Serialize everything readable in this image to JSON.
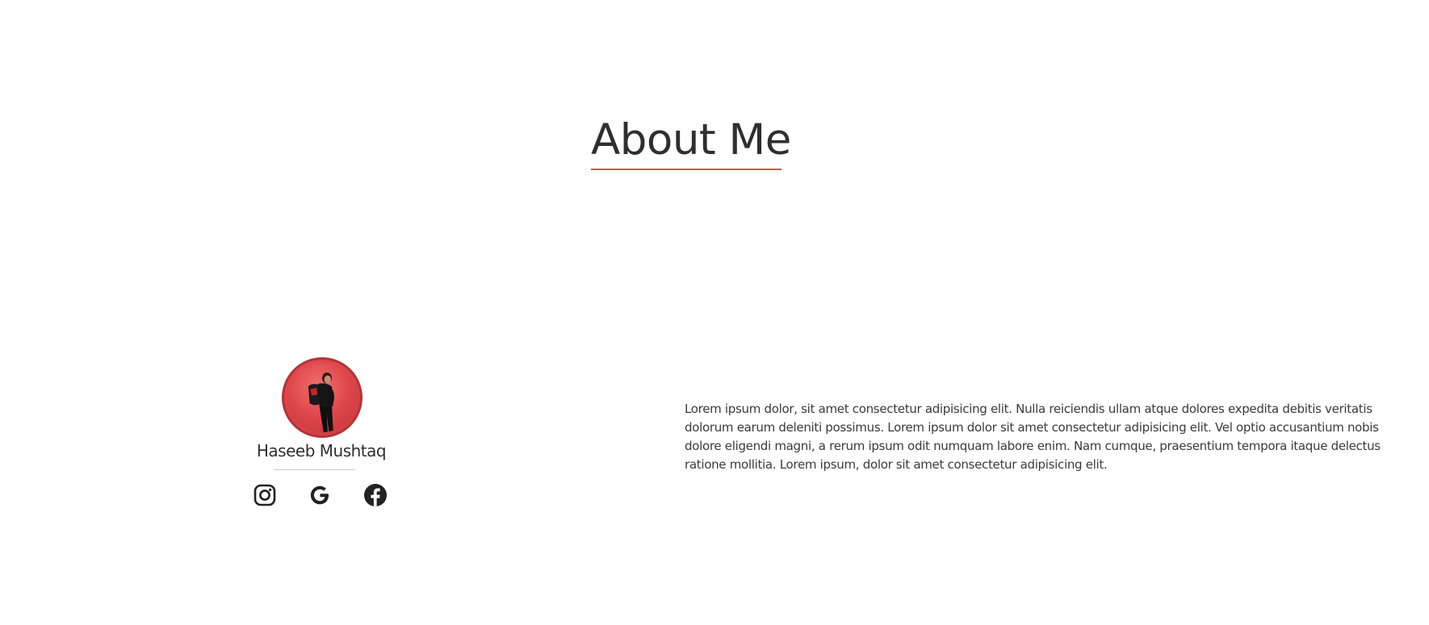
{
  "section": {
    "title": "About Me",
    "accent_color": "#e8494b"
  },
  "profile": {
    "name": "Haseeb Mushtaq",
    "avatar_icon": "person-photo",
    "avatar_border_color": "#b0353a",
    "social_links": [
      {
        "icon": "instagram-icon"
      },
      {
        "icon": "google-icon"
      },
      {
        "icon": "facebook-icon"
      }
    ]
  },
  "about": {
    "text": "Lorem ipsum dolor, sit amet consectetur adipisicing elit. Nulla reiciendis ullam atque dolores expedita debitis veritatis dolorum earum deleniti possimus. Lorem ipsum dolor sit amet consectetur adipisicing elit. Vel optio accusantium nobis dolore eligendi magni, a rerum ipsum odit numquam labore enim. Nam cumque, praesentium tempora itaque delectus ratione mollitia. Lorem ipsum, dolor sit amet consectetur adipisicing elit."
  }
}
